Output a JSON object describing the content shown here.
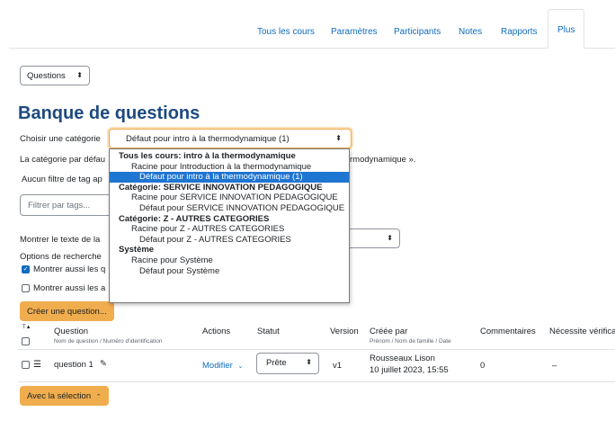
{
  "nav": {
    "tabs": [
      {
        "label": "Tous les cours"
      },
      {
        "label": "Paramètres"
      },
      {
        "label": "Participants"
      },
      {
        "label": "Notes"
      },
      {
        "label": "Rapports"
      },
      {
        "label": "Plus"
      }
    ]
  },
  "page_select": {
    "value": "Questions"
  },
  "title": "Banque de questions",
  "category": {
    "label": "Choisir une catégorie",
    "value": "Défaut pour intro à la thermodynamique (1)"
  },
  "info_text_left": "La catégorie par défau",
  "info_text_right": "rmodynamique ».",
  "tag_filter_label": "Aucun filtre de tag ap",
  "tag_input_placeholder": "Filtrer par tags...",
  "show_text_label": "Montrer le texte de la",
  "search_options_label": "Options de recherche",
  "opt_show_also_q": "Montrer aussi les q",
  "opt_show_also_a": "Montrer aussi les a",
  "create_button": "Créer une question...",
  "dropdown": {
    "items": [
      {
        "kind": "group",
        "label": "Tous les cours: intro à la thermodynamique"
      },
      {
        "kind": "option",
        "level": 1,
        "label": "Racine pour Introduction à la thermodynamique"
      },
      {
        "kind": "option",
        "level": 2,
        "label": "Défaut pour intro à la thermodynamique (1)",
        "selected": true
      },
      {
        "kind": "group",
        "label": "Catégorie: SERVICE INNOVATION PEDAGOGIQUE"
      },
      {
        "kind": "option",
        "level": 1,
        "label": "Racine pour SERVICE INNOVATION PEDAGOGIQUE"
      },
      {
        "kind": "option",
        "level": 2,
        "label": "Défaut pour SERVICE INNOVATION PEDAGOGIQUE"
      },
      {
        "kind": "group",
        "label": "Catégorie: Z - AUTRES CATEGORIES"
      },
      {
        "kind": "option",
        "level": 1,
        "label": "Racine pour Z - AUTRES CATEGORIES"
      },
      {
        "kind": "option",
        "level": 2,
        "label": "Défaut pour Z - AUTRES CATEGORIES"
      },
      {
        "kind": "group",
        "label": "Système"
      },
      {
        "kind": "option",
        "level": 1,
        "label": "Racine pour Système"
      },
      {
        "kind": "option",
        "level": 2,
        "label": "Défaut pour Système"
      }
    ]
  },
  "table": {
    "headers": {
      "sort_icon": "T",
      "question": "Question",
      "question_sub": "Nom de question / Numéro d'identification",
      "actions": "Actions",
      "status": "Statut",
      "version": "Version",
      "created_by": "Créée par",
      "created_by_sub": "Prénom / Nom de famille / Date",
      "comments": "Commentaires",
      "needs_check": "Nécessite vérifica"
    },
    "rows": [
      {
        "name": "question 1",
        "action": "Modifier",
        "status": "Prête",
        "version": "v1",
        "author": "Rousseaux Lison",
        "date": "10 juillet 2023, 15:55",
        "comments": "0",
        "needs_check": "–"
      }
    ]
  },
  "with_selection_button": "Avec la sélection"
}
